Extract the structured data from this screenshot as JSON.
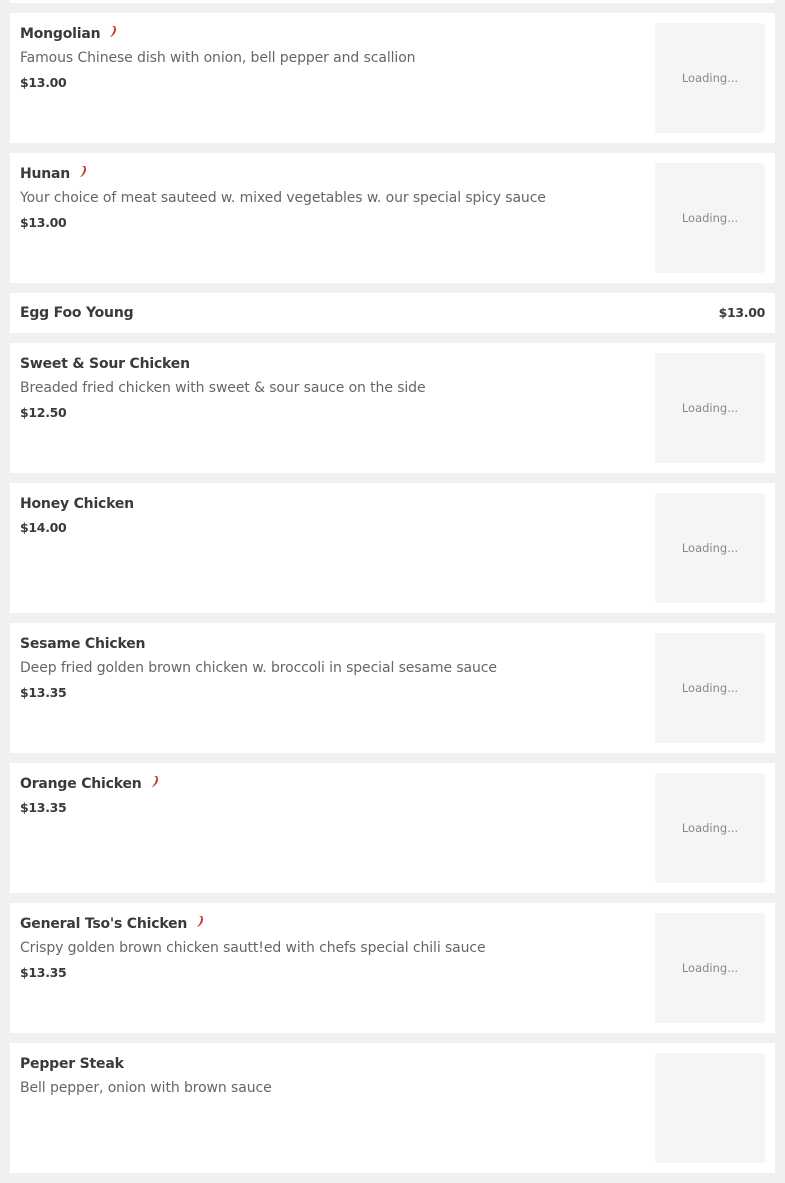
{
  "menu": {
    "thumb_loading_text": "Loading...",
    "spicy_icon_color": "#c0392b",
    "items": [
      {
        "name": "Mongolian",
        "spicy": true,
        "description": "Famous Chinese dish with onion, bell pepper and scallion",
        "price": "$13.00"
      },
      {
        "name": "Hunan",
        "spicy": true,
        "description": "Your choice of meat sauteed w. mixed vegetables w. our special spicy sauce",
        "price": "$13.00"
      },
      {
        "name": "Egg Foo Young",
        "spicy": false,
        "price": "$13.00"
      },
      {
        "name": "Sweet & Sour Chicken",
        "spicy": false,
        "description": "Breaded fried chicken with sweet & sour sauce on the side",
        "price": "$12.50"
      },
      {
        "name": "Honey Chicken",
        "spicy": false,
        "price": "$14.00"
      },
      {
        "name": "Sesame Chicken",
        "spicy": false,
        "description": "Deep fried golden brown chicken w. broccoli in special sesame sauce",
        "price": "$13.35"
      },
      {
        "name": "Orange Chicken",
        "spicy": true,
        "price": "$13.35"
      },
      {
        "name": "General Tso's Chicken",
        "spicy": true,
        "description": "Crispy golden brown chicken sautt!ed with chefs special chili sauce",
        "price": "$13.35"
      },
      {
        "name": "Pepper Steak",
        "spicy": false,
        "description": "Bell pepper, onion with brown sauce"
      }
    ]
  }
}
